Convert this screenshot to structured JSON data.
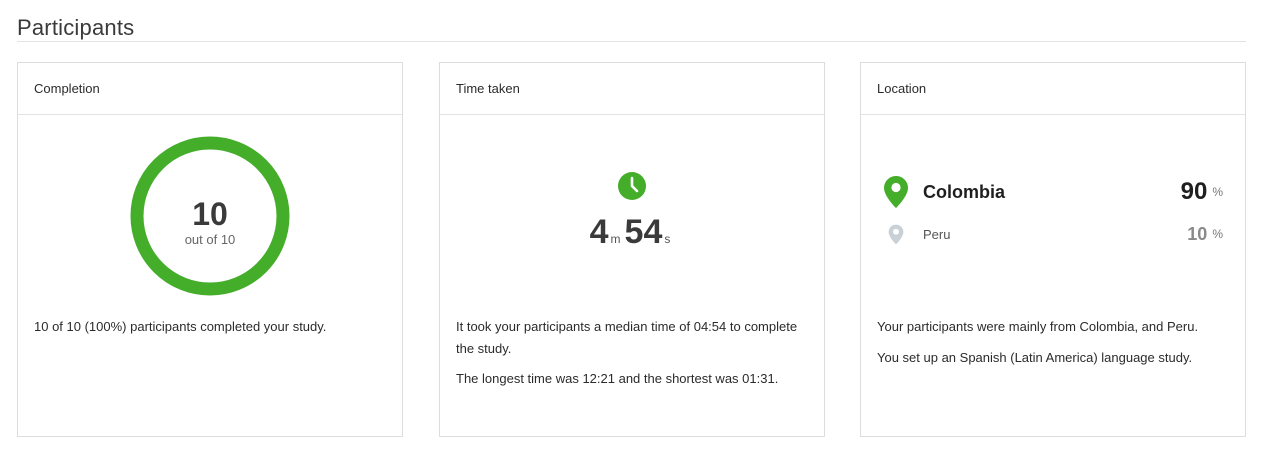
{
  "section": {
    "title": "Participants"
  },
  "completion": {
    "header": "Completion",
    "count": "10",
    "out_of": "out of 10",
    "fraction_complete": 1.0,
    "summary": "10 of 10 (100%) participants completed your study."
  },
  "time_taken": {
    "header": "Time taken",
    "minutes": "4",
    "minutes_unit": "m",
    "seconds": "54",
    "seconds_unit": "s",
    "summary_line1": "It took your participants a median time of 04:54 to complete the study.",
    "summary_line2": "The longest time was 12:21 and the shortest was 01:31."
  },
  "location": {
    "header": "Location",
    "rows": [
      {
        "name": "Colombia",
        "percent": "90",
        "symbol": "%"
      },
      {
        "name": "Peru",
        "percent": "10",
        "symbol": "%"
      }
    ],
    "summary_line1": "Your participants were mainly from Colombia, and Peru.",
    "summary_line2": "You set up an Spanish (Latin America) language study."
  },
  "colors": {
    "accent_green": "#44ad2a",
    "muted_pin": "#c9d0d6"
  }
}
